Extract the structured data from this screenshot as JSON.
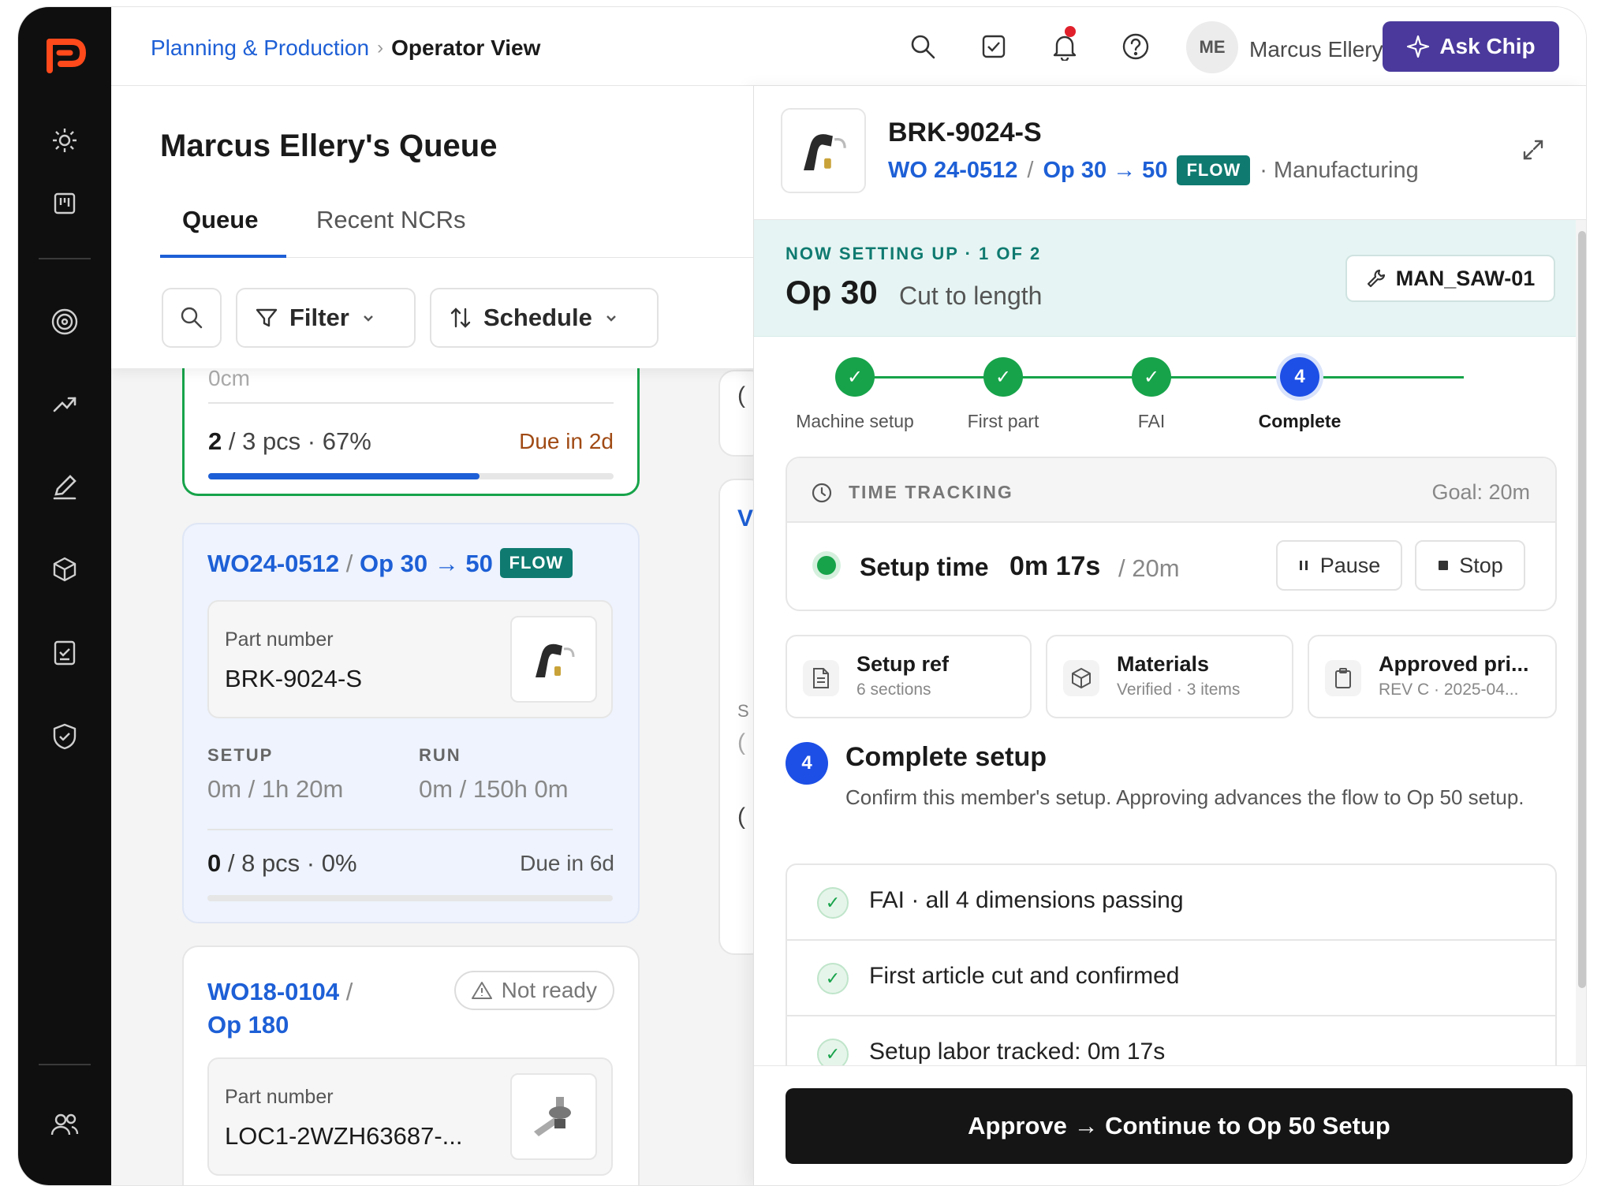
{
  "breadcrumb": {
    "parent": "Planning & Production",
    "separator": "›",
    "current": "Operator View"
  },
  "header": {
    "user_initials": "ME",
    "user_name": "Marcus Ellery",
    "ask_label": "Ask Chip",
    "icons": [
      "search-icon",
      "task-check-icon",
      "bell-icon",
      "help-icon"
    ]
  },
  "queue": {
    "title": "Marcus Ellery's Queue",
    "tabs": [
      {
        "label": "Queue",
        "active": true
      },
      {
        "label": "Recent NCRs",
        "active": false
      }
    ],
    "filter_label": "Filter",
    "schedule_label": "Schedule",
    "cards": [
      {
        "truncated_top": "0cm",
        "done": "2",
        "pcs_rest": " / 3 pcs · 67%",
        "progress": 0.67,
        "due": "Due in 2d",
        "due_color": "#a04a14"
      },
      {
        "wo": "WO24-0512",
        "sep": "/",
        "op": "Op 30 → 50",
        "badge": "FLOW",
        "part_label": "Part number",
        "part": "BRK-9024-S",
        "setup_label": "SETUP",
        "setup_val": "0m / 1h 20m",
        "run_label": "RUN",
        "run_val": "0m / 150h 0m",
        "done": "0",
        "pcs_rest": " / 8 pcs · 0%",
        "progress": 0,
        "due": "Due in 6d"
      },
      {
        "wo": "WO18-0104",
        "sep": "/",
        "op": "Op 180",
        "status": "Not ready",
        "part_label": "Part number",
        "part": "LOC1-2WZH63687-..."
      }
    ],
    "ghost_texts": [
      "(",
      "V",
      "S",
      "(",
      "("
    ]
  },
  "detail": {
    "part": "BRK-9024-S",
    "wo": "WO 24-0512",
    "sep": "/",
    "op": "Op 30 → 50",
    "badge": "FLOW",
    "dept": "· Manufacturing",
    "banner_label": "NOW SETTING UP · 1 OF 2",
    "op_num": "Op 30",
    "op_desc": "Cut to length",
    "machine": "MAN_SAW-01",
    "steps": [
      {
        "label": "Machine setup",
        "state": "done"
      },
      {
        "label": "First part",
        "state": "done"
      },
      {
        "label": "FAI",
        "state": "done"
      },
      {
        "label": "Complete",
        "state": "current",
        "num": "4"
      }
    ],
    "check_glyph": "✓",
    "time": {
      "title": "TIME TRACKING",
      "goal": "Goal: 20m",
      "label": "Setup time",
      "value": "0m 17s",
      "target": "/ 20m",
      "pause": "Pause",
      "stop": "Stop"
    },
    "refs": [
      {
        "title": "Setup ref",
        "sub": "6 sections",
        "icon": "document-icon"
      },
      {
        "title": "Materials",
        "sub": "Verified · 3 items",
        "icon": "box-icon"
      },
      {
        "title": "Approved pri...",
        "sub": "REV C · 2025-04...",
        "icon": "clipboard-icon"
      }
    ],
    "complete": {
      "num": "4",
      "title": "Complete setup",
      "desc": "Confirm this member's setup. Approving advances the flow to Op 50 setup."
    },
    "checks": [
      "FAI · all 4 dimensions passing",
      "First article cut and confirmed",
      "Setup labor tracked: 0m 17s"
    ],
    "approve_label": "Approve → Continue to Op 50 Setup"
  }
}
